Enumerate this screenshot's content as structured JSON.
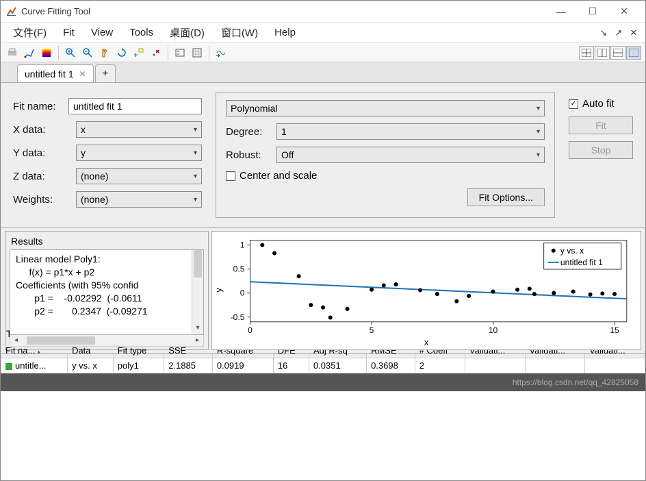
{
  "window": {
    "title": "Curve Fitting Tool"
  },
  "menu": [
    "文件(F)",
    "Fit",
    "View",
    "Tools",
    "桌面(D)",
    "窗口(W)",
    "Help"
  ],
  "tab": {
    "label": "untitled fit 1"
  },
  "config": {
    "fit_name_label": "Fit name:",
    "fit_name_value": "untitled fit 1",
    "x_label": "X data:",
    "x_value": "x",
    "y_label": "Y data:",
    "y_value": "y",
    "z_label": "Z data:",
    "z_value": "(none)",
    "w_label": "Weights:",
    "w_value": "(none)",
    "model_type": "Polynomial",
    "degree_label": "Degree:",
    "degree_value": "1",
    "robust_label": "Robust:",
    "robust_value": "Off",
    "center_label": "Center and scale",
    "fitopts_label": "Fit Options...",
    "autofit_label": "Auto fit",
    "fit_btn": "Fit",
    "stop_btn": "Stop"
  },
  "results": {
    "title": "Results",
    "text": "Linear model Poly1:\n     f(x) = p1*x + p2\nCoefficients (with 95% confid\n       p1 =    -0.02292  (-0.0611\n       p2 =       0.2347  (-0.09271"
  },
  "chart_data": {
    "type": "scatter+line",
    "xlabel": "x",
    "ylabel": "y",
    "xlim": [
      0,
      15.5
    ],
    "ylim": [
      -0.6,
      1.1
    ],
    "xticks": [
      0,
      5,
      10,
      15
    ],
    "yticks": [
      -0.5,
      0,
      0.5,
      1
    ],
    "series": [
      {
        "name": "y vs. x",
        "type": "scatter",
        "x": [
          0.5,
          1,
          2,
          2.5,
          3,
          3.3,
          4,
          5,
          5.5,
          6,
          7,
          7.7,
          8.5,
          9,
          10,
          11,
          11.5,
          11.7,
          12.5,
          13.3,
          14,
          14.5,
          15
        ],
        "y": [
          1.0,
          0.83,
          0.35,
          -0.25,
          -0.3,
          -0.51,
          -0.33,
          0.07,
          0.16,
          0.18,
          0.06,
          -0.02,
          -0.17,
          -0.06,
          0.03,
          0.07,
          0.09,
          -0.02,
          0.0,
          0.03,
          -0.03,
          -0.01,
          -0.02
        ]
      },
      {
        "name": "untitled fit 1",
        "type": "line",
        "p1": -0.02292,
        "p2": 0.2347,
        "x": [
          0,
          15.5
        ],
        "y": [
          0.2347,
          -0.1206
        ]
      }
    ],
    "legend": [
      "y vs. x",
      "untitled fit 1"
    ]
  },
  "fits": {
    "title": "Table of Fits",
    "headers": [
      "Fit na...",
      "Data",
      "Fit type",
      "SSE",
      "R-square",
      "DFE",
      "Adj R-sq",
      "RMSE",
      "# Coeff",
      "Validati...",
      "Validati...",
      "Validati..."
    ],
    "row": {
      "name": "untitle...",
      "data": "y vs. x",
      "type": "poly1",
      "sse": "2.1885",
      "rsq": "0.0919",
      "dfe": "16",
      "adjrsq": "0.0351",
      "rmse": "0.3698",
      "ncoeff": "2",
      "v1": "",
      "v2": "",
      "v3": ""
    }
  },
  "status": {
    "watermark": "https://blog.csdn.net/qq_42825058"
  }
}
